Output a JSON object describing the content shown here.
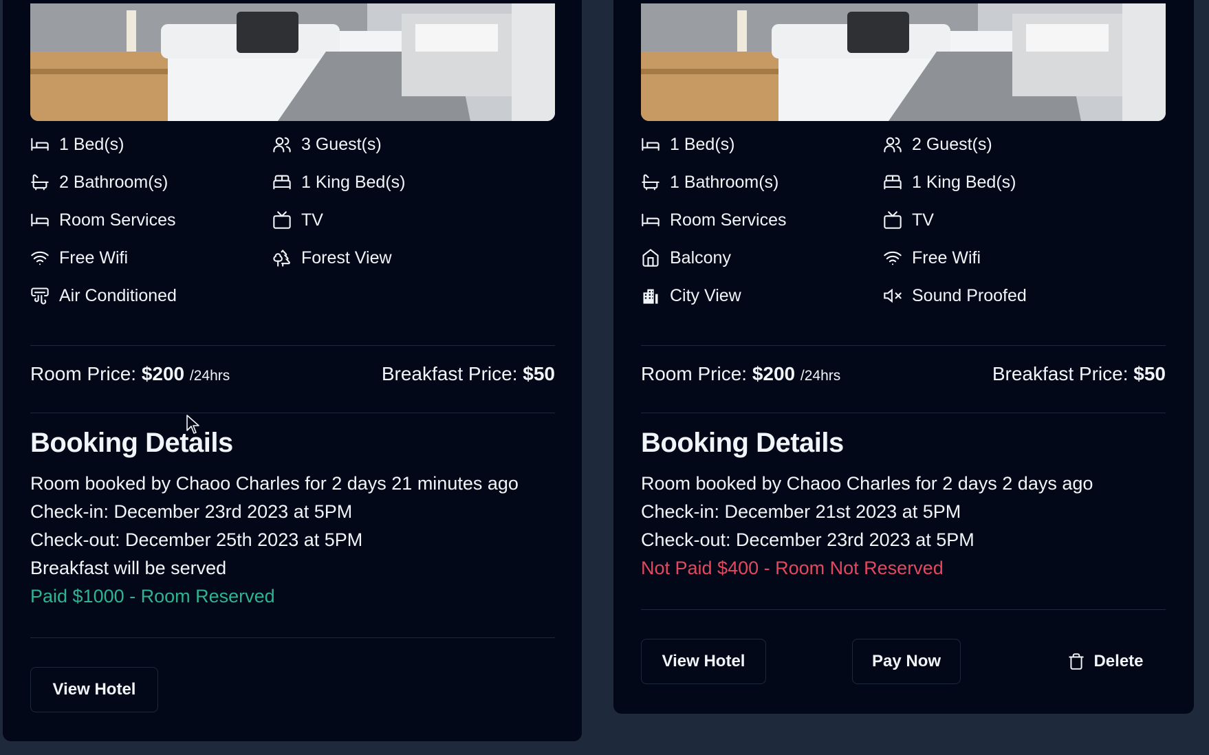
{
  "cards": [
    {
      "amenities": [
        {
          "icon": "bed-icon",
          "label": "1 Bed(s)"
        },
        {
          "icon": "users-icon",
          "label": "3 Guest(s)"
        },
        {
          "icon": "bath-icon",
          "label": "2 Bathroom(s)"
        },
        {
          "icon": "bed-double-icon",
          "label": "1 King Bed(s)"
        },
        {
          "icon": "bed-icon",
          "label": "Room Services"
        },
        {
          "icon": "tv-icon",
          "label": "TV"
        },
        {
          "icon": "wifi-icon",
          "label": "Free Wifi"
        },
        {
          "icon": "trees-icon",
          "label": "Forest View"
        },
        {
          "icon": "air-vent-icon",
          "label": "Air Conditioned"
        }
      ],
      "room_price_label": "Room Price:",
      "room_price": "$200",
      "room_price_unit": "/24hrs",
      "breakfast_price_label": "Breakfast Price:",
      "breakfast_price": "$50",
      "booking_title": "Booking Details",
      "booked_by": "Room booked by Chaoo Charles for 2 days 21 minutes ago",
      "check_in": "Check-in: December 23rd 2023 at 5PM",
      "check_out": "Check-out: December 25th 2023 at 5PM",
      "breakfast_note": "Breakfast will be served",
      "payment_status": "Paid $1000 - Room Reserved",
      "payment_color": "#2fb491",
      "buttons": {
        "view_hotel": "View Hotel"
      }
    },
    {
      "amenities": [
        {
          "icon": "bed-icon",
          "label": "1 Bed(s)"
        },
        {
          "icon": "users-icon",
          "label": "2 Guest(s)"
        },
        {
          "icon": "bath-icon",
          "label": "1 Bathroom(s)"
        },
        {
          "icon": "bed-double-icon",
          "label": "1 King Bed(s)"
        },
        {
          "icon": "bed-icon",
          "label": "Room Services"
        },
        {
          "icon": "tv-icon",
          "label": "TV"
        },
        {
          "icon": "home-icon",
          "label": "Balcony"
        },
        {
          "icon": "wifi-icon",
          "label": "Free Wifi"
        },
        {
          "icon": "building-icon",
          "label": "City View"
        },
        {
          "icon": "volume-x-icon",
          "label": "Sound Proofed"
        }
      ],
      "room_price_label": "Room Price:",
      "room_price": "$200",
      "room_price_unit": "/24hrs",
      "breakfast_price_label": "Breakfast Price:",
      "breakfast_price": "$50",
      "booking_title": "Booking Details",
      "booked_by": "Room booked by Chaoo Charles for 2 days 2 days ago",
      "check_in": "Check-in: December 21st 2023 at 5PM",
      "check_out": "Check-out: December 23rd 2023 at 5PM",
      "payment_status": "Not Paid $400 - Room Not Reserved",
      "payment_color": "#e5485e",
      "buttons": {
        "view_hotel": "View Hotel",
        "pay_now": "Pay Now",
        "delete": "Delete"
      }
    }
  ]
}
